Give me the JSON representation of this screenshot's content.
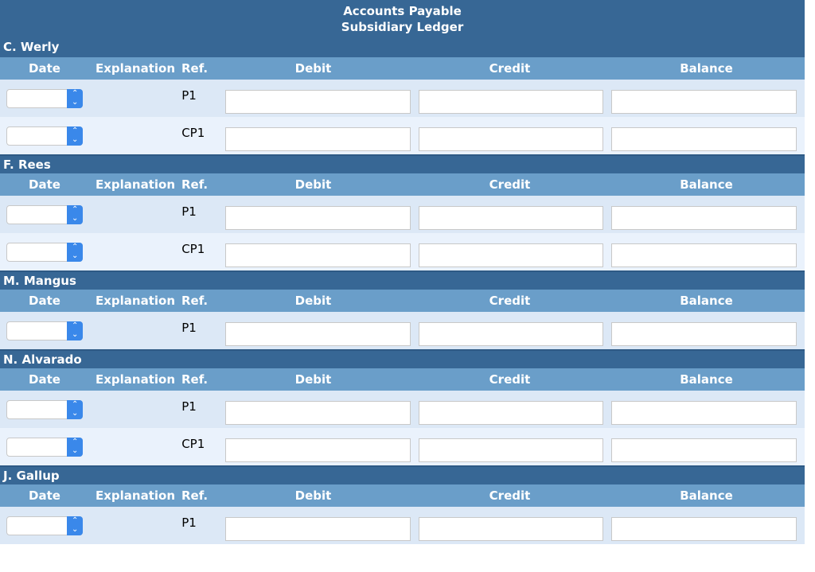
{
  "title": {
    "line1": "Accounts Payable",
    "line2": "Subsidiary Ledger"
  },
  "columns": {
    "date": "Date",
    "explanation": "Explanation",
    "ref": "Ref.",
    "debit": "Debit",
    "credit": "Credit",
    "balance": "Balance"
  },
  "accounts": [
    {
      "name": "C. Werly",
      "rows": [
        {
          "ref": "P1",
          "date": "",
          "debit": "",
          "credit": "",
          "balance": ""
        },
        {
          "ref": "CP1",
          "date": "",
          "debit": "",
          "credit": "",
          "balance": ""
        }
      ]
    },
    {
      "name": "F. Rees",
      "rows": [
        {
          "ref": "P1",
          "date": "",
          "debit": "",
          "credit": "",
          "balance": ""
        },
        {
          "ref": "CP1",
          "date": "",
          "debit": "",
          "credit": "",
          "balance": ""
        }
      ]
    },
    {
      "name": "M. Mangus",
      "rows": [
        {
          "ref": "P1",
          "date": "",
          "debit": "",
          "credit": "",
          "balance": ""
        }
      ]
    },
    {
      "name": "N. Alvarado",
      "rows": [
        {
          "ref": "P1",
          "date": "",
          "debit": "",
          "credit": "",
          "balance": ""
        },
        {
          "ref": "CP1",
          "date": "",
          "debit": "",
          "credit": "",
          "balance": ""
        }
      ]
    },
    {
      "name": "J. Gallup",
      "rows": [
        {
          "ref": "P1",
          "date": "",
          "debit": "",
          "credit": "",
          "balance": ""
        }
      ]
    }
  ]
}
